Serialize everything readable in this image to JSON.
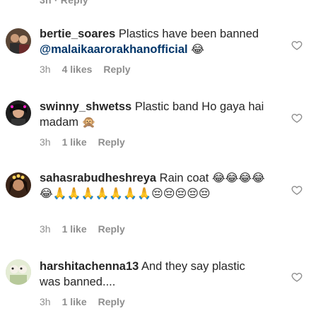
{
  "top_partial": "3h  · Reply",
  "comments": [
    {
      "username": "bertie_soares",
      "text_before": " Plastics have been banned ",
      "mention": "@malaikaarorakhanofficial",
      "emoji": "😂",
      "time": "3h",
      "likes": "4 likes",
      "reply": "Reply",
      "avatar_bg": "#7a5a3c"
    },
    {
      "username": "swinny_shwetss",
      "text": " Plastic band Ho gaya hai madam ",
      "emoji": "🙊",
      "time": "3h",
      "likes": "1 like",
      "reply": "Reply",
      "avatar_bg": "#2a2a2a"
    },
    {
      "username": "sahasrabudheshreya",
      "text": " Rain coat ",
      "emoji": "😂😂😂😂😂🙏🙏🙏🙏🙏🙏🙏😔😔😔😔😔",
      "time": "3h",
      "likes": "1 like",
      "reply": "Reply",
      "avatar_bg": "#5a3b2a"
    },
    {
      "username": "harshitachenna13",
      "text": " And they say plastic was banned....",
      "time": "3h",
      "likes": "1 like",
      "reply": "Reply",
      "avatar_bg": "#d8e6c0"
    }
  ],
  "colors": {
    "text": "#262626",
    "meta": "#8e8e8e",
    "mention": "#003569",
    "heart": "#8e8e8e"
  },
  "icons": {
    "heart": "heart-outline-icon"
  }
}
